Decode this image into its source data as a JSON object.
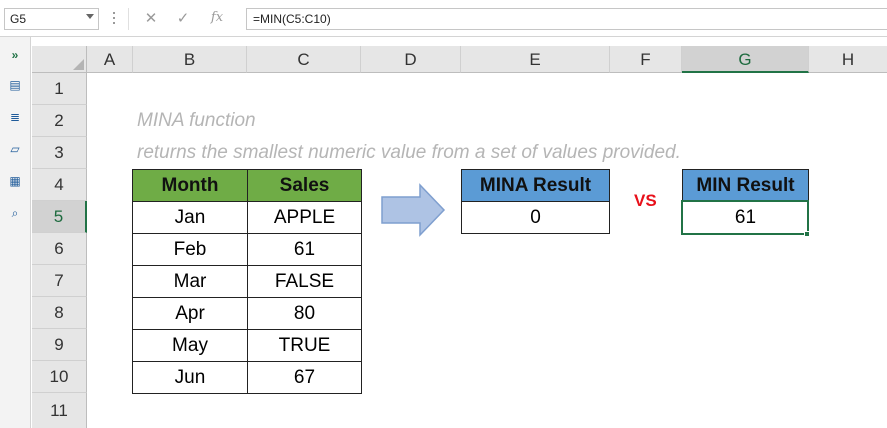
{
  "formula_bar": {
    "name_box": "G5",
    "formula": "=MIN(C5:C10)",
    "fx_label": "fx"
  },
  "side_toolbar": {
    "expand_label": "»",
    "icons": [
      "navigation-pane-icon",
      "navigation-pane-icon",
      "workbook-icon",
      "grid-icon",
      "find-icon"
    ]
  },
  "columns": [
    "A",
    "B",
    "C",
    "D",
    "E",
    "F",
    "G",
    "H"
  ],
  "rows": [
    "1",
    "2",
    "3",
    "4",
    "5",
    "6",
    "7",
    "8",
    "9",
    "10",
    "11"
  ],
  "selected_cell": "G5",
  "notes": {
    "line1": "MINA function",
    "line2": "returns the smallest numeric value from a set of values provided."
  },
  "data_table": {
    "headers": [
      "Month",
      "Sales"
    ],
    "rows": [
      [
        "Jan",
        "APPLE"
      ],
      [
        "Feb",
        "61"
      ],
      [
        "Mar",
        "FALSE"
      ],
      [
        "Apr",
        "80"
      ],
      [
        "May",
        "TRUE"
      ],
      [
        "Jun",
        "67"
      ]
    ]
  },
  "mina": {
    "header": "MINA Result",
    "value": "0"
  },
  "vs_label": "VS",
  "min": {
    "header": "MIN Result",
    "value": "61"
  },
  "colors": {
    "month_sales_header": "#6fac46",
    "result_header": "#5b9bd5",
    "vs": "#e8101a",
    "selection": "#217346",
    "note_text": "#b5b5b5"
  }
}
